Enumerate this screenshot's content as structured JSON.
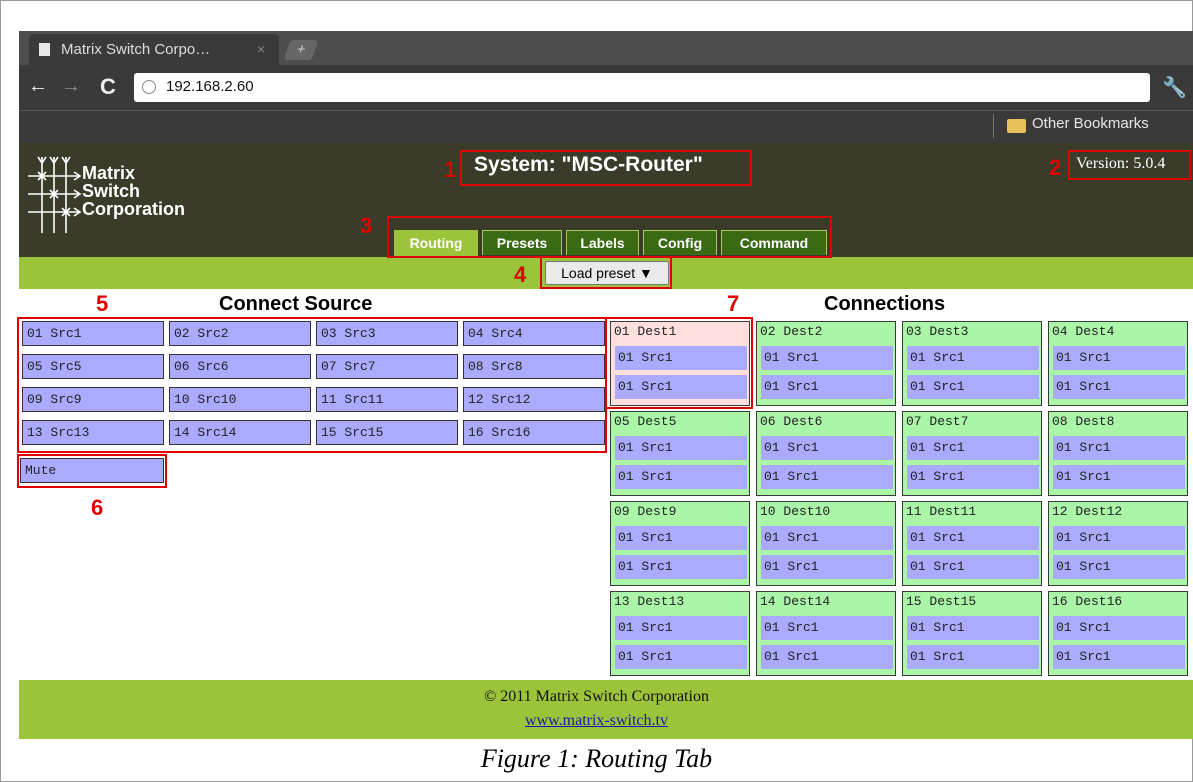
{
  "browser": {
    "tab_title": "Matrix Switch Corpo…",
    "tab_close": "×",
    "new_tab": "+",
    "url": "192.168.2.60",
    "bookmark": "Other Bookmarks"
  },
  "header": {
    "logo_lines": [
      "Matrix",
      "Switch",
      "Corporation"
    ],
    "system": "System: \"MSC-Router\"",
    "version": "Version: 5.0.4"
  },
  "tabs": [
    "Routing",
    "Presets",
    "Labels",
    "Config",
    "Command"
  ],
  "load_preset": "Load preset ▼",
  "connect_source_title": "Connect Source",
  "connections_title": "Connections",
  "sources": [
    "01 Src1",
    "02 Src2",
    "03 Src3",
    "04 Src4",
    "05 Src5",
    "06 Src6",
    "07 Src7",
    "08 Src8",
    "09 Src9",
    "10 Src10",
    "11 Src11",
    "12 Src12",
    "13 Src13",
    "14 Src14",
    "15 Src15",
    "16 Src16"
  ],
  "mute": "Mute",
  "destinations": [
    {
      "name": "01 Dest1",
      "slots": [
        "01 Src1",
        "01 Src1"
      ],
      "selected": true
    },
    {
      "name": "02 Dest2",
      "slots": [
        "01 Src1",
        "01 Src1"
      ]
    },
    {
      "name": "03 Dest3",
      "slots": [
        "01 Src1",
        "01 Src1"
      ]
    },
    {
      "name": "04 Dest4",
      "slots": [
        "01 Src1",
        "01 Src1"
      ]
    },
    {
      "name": "05 Dest5",
      "slots": [
        "01 Src1",
        "01 Src1"
      ]
    },
    {
      "name": "06 Dest6",
      "slots": [
        "01 Src1",
        "01 Src1"
      ]
    },
    {
      "name": "07 Dest7",
      "slots": [
        "01 Src1",
        "01 Src1"
      ]
    },
    {
      "name": "08 Dest8",
      "slots": [
        "01 Src1",
        "01 Src1"
      ]
    },
    {
      "name": "09 Dest9",
      "slots": [
        "01 Src1",
        "01 Src1"
      ]
    },
    {
      "name": "10 Dest10",
      "slots": [
        "01 Src1",
        "01 Src1"
      ]
    },
    {
      "name": "11 Dest11",
      "slots": [
        "01 Src1",
        "01 Src1"
      ]
    },
    {
      "name": "12 Dest12",
      "slots": [
        "01 Src1",
        "01 Src1"
      ]
    },
    {
      "name": "13 Dest13",
      "slots": [
        "01 Src1",
        "01 Src1"
      ]
    },
    {
      "name": "14 Dest14",
      "slots": [
        "01 Src1",
        "01 Src1"
      ]
    },
    {
      "name": "15 Dest15",
      "slots": [
        "01 Src1",
        "01 Src1"
      ]
    },
    {
      "name": "16 Dest16",
      "slots": [
        "01 Src1",
        "01 Src1"
      ]
    }
  ],
  "footer": {
    "copyright": "© 2011 Matrix Switch Corporation",
    "website": "www.matrix-switch.tv"
  },
  "caption": "Figure 1: Routing Tab",
  "callouts": [
    "1",
    "2",
    "3",
    "4",
    "5",
    "6",
    "7"
  ],
  "colors": {
    "accent_green": "#9bc43a",
    "source_blue": "#aaaaff",
    "dest_green": "#aaf5a8",
    "annotation_red": "#e00000"
  }
}
